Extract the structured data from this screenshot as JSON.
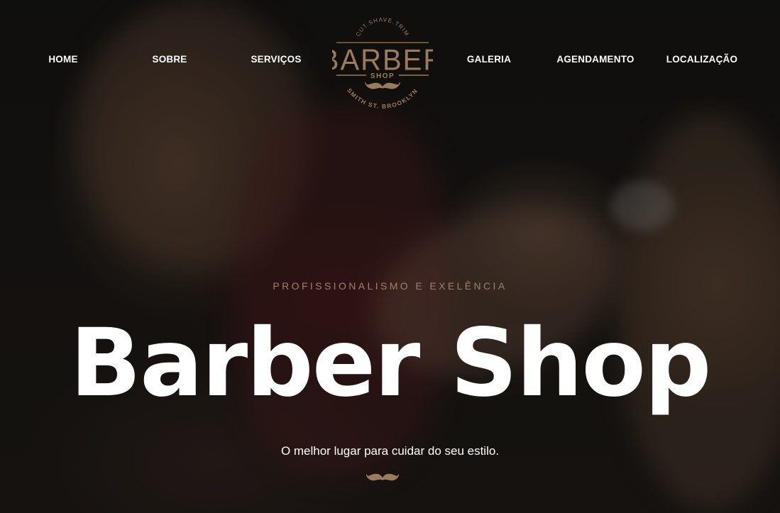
{
  "nav": {
    "items": [
      {
        "label": "HOME"
      },
      {
        "label": "SOBRE"
      },
      {
        "label": "SERVIÇOS"
      },
      {
        "label": "GALERIA"
      },
      {
        "label": "AGENDAMENTO"
      },
      {
        "label": "LOCALIZAÇÃO"
      }
    ]
  },
  "logo": {
    "top_text": "CUT.SHAVE.TRIM",
    "main_text": "BARBER",
    "sub_text": "SHOP",
    "bottom_text": "SMITH ST. BROOKLYN"
  },
  "hero": {
    "eyebrow": "PROFISSIONALISMO E EXELÊNCIA",
    "headline": "Barber Shop",
    "tagline": "O melhor lugar para cuidar do seu estilo."
  },
  "colors": {
    "accent": "#9c7a5c",
    "text": "#ffffff",
    "background": "#141311"
  },
  "icons": {
    "decor": "mustache-icon"
  }
}
